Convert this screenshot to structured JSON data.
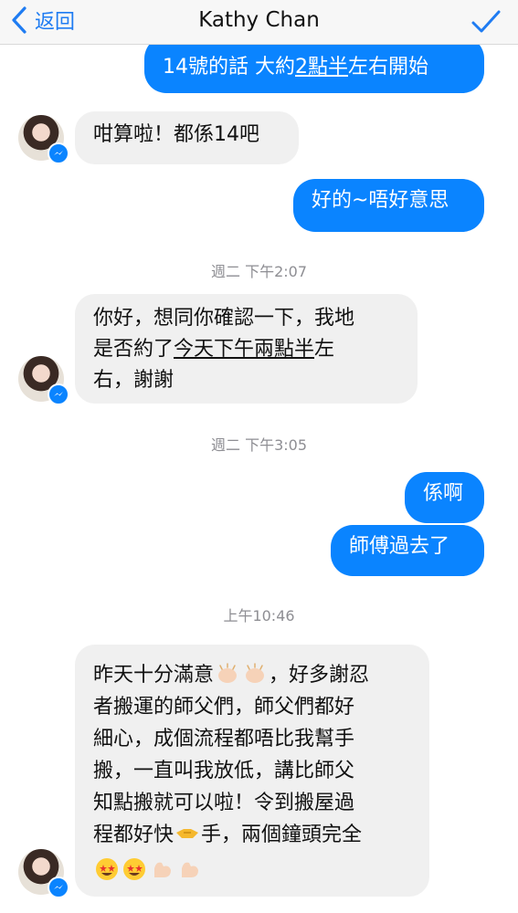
{
  "header": {
    "back_label": "返回",
    "title": "Kathy Chan"
  },
  "messages": {
    "m1": {
      "before": "14號的話 大約",
      "underlined": "2點半",
      "after": "左右開始"
    },
    "m2": {
      "text": "咁算啦！都係14吧"
    },
    "m3": {
      "text": "好的~唔好意思"
    },
    "ts1": "週二 下午2:07",
    "m4": {
      "line1": "你好，想同你確認一下，我地",
      "line2_before": "是否約了",
      "line2_underlined": "今天下午兩點半",
      "line2_after": "左",
      "line3": "右，謝謝"
    },
    "ts2": "週二 下午3:05",
    "m5": {
      "text": "係啊"
    },
    "m6": {
      "text": "師傅過去了"
    },
    "ts3": "上午10:46",
    "m7": {
      "line1_before": "昨天十分滿意",
      "line1_after": "，好多謝忍",
      "line2": "者搬運的師父們，師父們都好",
      "line3": "細心，成個流程都唔比我幫手",
      "line4": "搬，一直叫我放低，講比師父",
      "line5": "知點搬就可以啦！令到搬屋過",
      "line6_before": "程都好快",
      "line6_after": "手，兩個鐘頭完全"
    }
  },
  "colors": {
    "accent": "#0a84ff",
    "incoming_bubble": "#f0f0f0",
    "timestamp": "#8e8e93"
  },
  "icons": {
    "back": "chevron-left-icon",
    "done": "checkmark-icon",
    "badge": "messenger-badge-icon",
    "emoji_clap": "clapping-hands-emoji",
    "emoji_handshake": "handshake-emoji",
    "emoji_star_eyes": "star-struck-emoji",
    "emoji_muscle": "flexed-biceps-emoji"
  }
}
